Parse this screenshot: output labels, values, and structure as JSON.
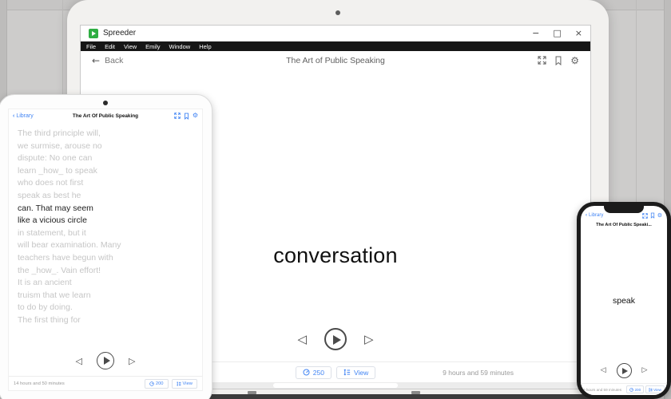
{
  "colors": {
    "accent": "#4285f4",
    "app_green": "#2fae43"
  },
  "desktop": {
    "window": {
      "title": "Spreeder",
      "minimize": "−",
      "maximize": "□",
      "close": "×"
    },
    "menu": {
      "items": [
        "File",
        "Edit",
        "View",
        "Emily",
        "Window",
        "Help"
      ]
    },
    "header": {
      "back_label": "Back",
      "title": "The Art of Public Speaking"
    },
    "reader": {
      "current_word": "conversation"
    },
    "footer": {
      "speed": "250",
      "view_label": "View",
      "time_remaining": "9 hours and 59 minutes"
    }
  },
  "tablet": {
    "header": {
      "back_label": "Library",
      "title": "The Art Of Public Speaking"
    },
    "lines": [
      {
        "text": "The third principle will,",
        "current": false
      },
      {
        "text": "we surmise, arouse no",
        "current": false
      },
      {
        "text": "dispute: No one can",
        "current": false
      },
      {
        "text": "learn _how_ to speak",
        "current": false
      },
      {
        "text": "who does not first",
        "current": false
      },
      {
        "text": "speak as best he",
        "current": false
      },
      {
        "text": "can. That may seem",
        "current": true
      },
      {
        "text": "like a vicious circle",
        "current": true
      },
      {
        "text": "in statement, but it",
        "current": false
      },
      {
        "text": "will bear examination. Many",
        "current": false
      },
      {
        "text": "teachers have begun with",
        "current": false
      },
      {
        "text": "the _how_. Vain effort!",
        "current": false
      },
      {
        "text": "It is an ancient",
        "current": false
      },
      {
        "text": "truism that we learn",
        "current": false
      },
      {
        "text": "to do by doing.",
        "current": false
      },
      {
        "text": "The first thing for",
        "current": false
      }
    ],
    "footer": {
      "time_remaining": "14 hours and 50 minutes",
      "speed": "200",
      "view_label": "View"
    }
  },
  "phone": {
    "header": {
      "back_label": "Library",
      "title": "The Art Of Public Speaki..."
    },
    "reader": {
      "current_word": "speak"
    },
    "footer": {
      "time_remaining": "9 hours and 59 minutes",
      "speed": "200",
      "view_label": "View"
    }
  }
}
